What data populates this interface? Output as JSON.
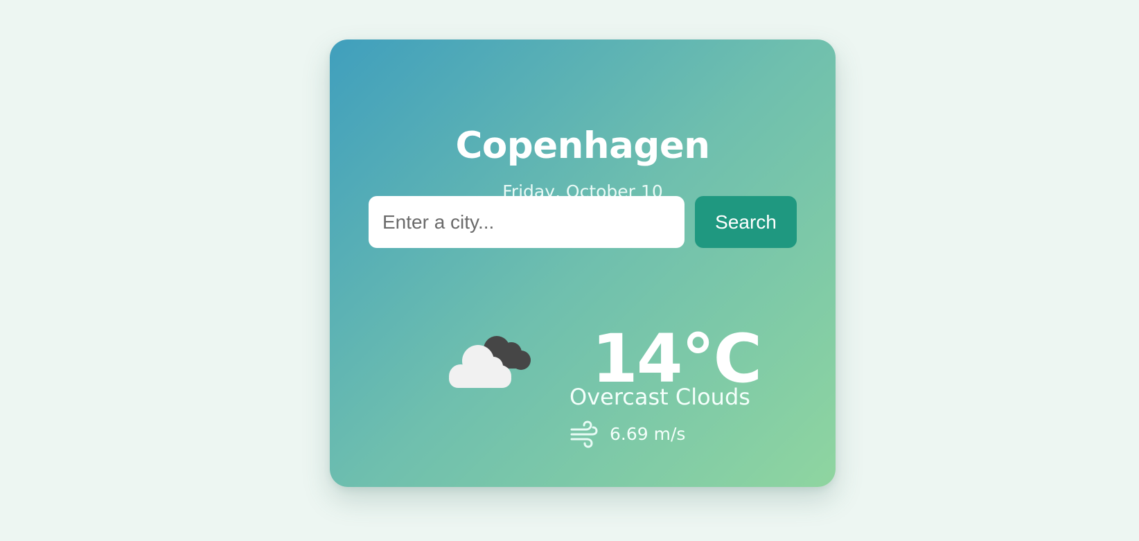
{
  "weather": {
    "city": "Copenhagen",
    "date": "Friday, October 10",
    "temperature": "14°C",
    "description": "Overcast Clouds",
    "wind_speed": "6.69 m/s",
    "condition_icon": "overcast-clouds-icon",
    "wind_icon": "wind-icon"
  },
  "search": {
    "placeholder": "Enter a city...",
    "value": "",
    "button_label": "Search"
  },
  "colors": {
    "background": "#edf6f2",
    "card_gradient_start": "#409fbd",
    "card_gradient_end": "#8fd5a0",
    "button": "#1f9880",
    "text": "#ffffff"
  }
}
